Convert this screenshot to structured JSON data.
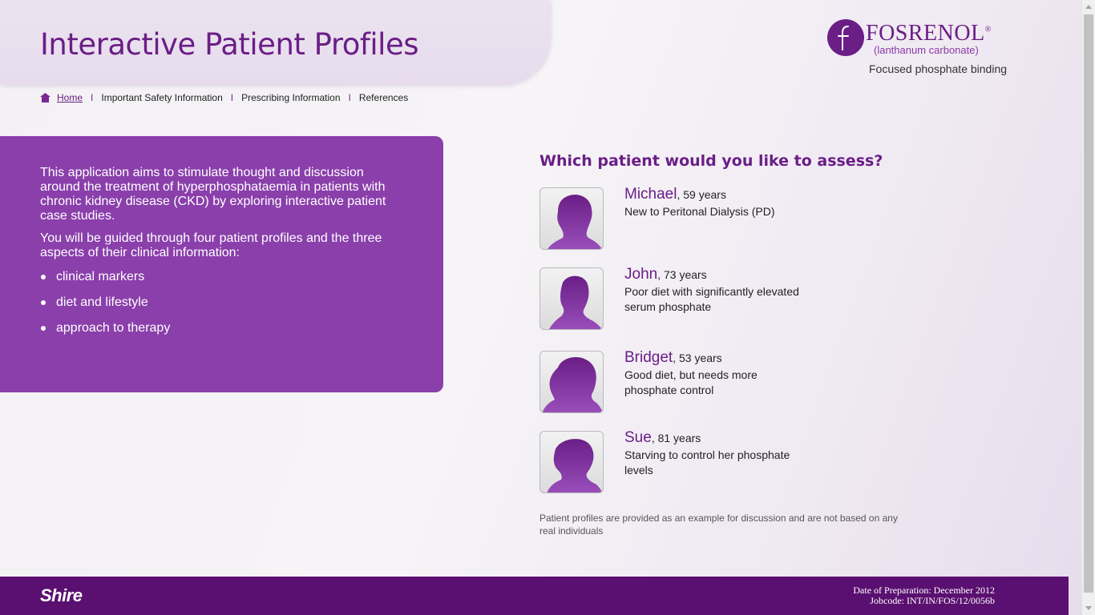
{
  "header": {
    "title": "Interactive Patient Profiles"
  },
  "nav": {
    "home": "Home",
    "items": [
      "Important Safety Information",
      "Prescribing Information",
      "References"
    ],
    "separator": "I"
  },
  "brand": {
    "logo_letter": "f",
    "name": "FOSRENOL",
    "registered": "®",
    "generic": "(lanthanum carbonate)",
    "tagline": "Focused phosphate binding",
    "color": "#6a1e86"
  },
  "intro": {
    "paragraphs": [
      "This application aims to stimulate thought and discussion around the treatment of hyperphosphataemia in patients with chronic kidney disease (CKD) by exploring interactive patient case studies.",
      "You will be guided through four patient profiles and the three aspects of their clinical information:"
    ],
    "bullets": [
      "clinical markers",
      "diet and lifestyle",
      "approach to therapy"
    ],
    "background_color": "#8a3fab"
  },
  "patients": {
    "question": "Which patient would you like to assess?",
    "list": [
      {
        "name": "Michael",
        "age": ", 59 years",
        "description": "New to Peritonal Dialysis (PD)"
      },
      {
        "name": "John",
        "age": ", 73 years",
        "description": "Poor diet with significantly elevated serum phosphate"
      },
      {
        "name": "Bridget",
        "age": ", 53 years",
        "description": "Good diet, but needs more phosphate control"
      },
      {
        "name": "Sue",
        "age": ", 81 years",
        "description": "Starving to control her phosphate levels"
      }
    ],
    "disclaimer": "Patient profiles are provided as an example for discussion and are not based on any real individuals"
  },
  "footer": {
    "company": "Shire",
    "date_of_preparation": "Date of Preparation: December 2012",
    "jobcode": "Jobcode: INT/IN/FOS/12/0056b",
    "background_color": "#5a1070"
  },
  "icons": {
    "home": "home-icon",
    "avatar": "patient-silhouette-icon"
  }
}
